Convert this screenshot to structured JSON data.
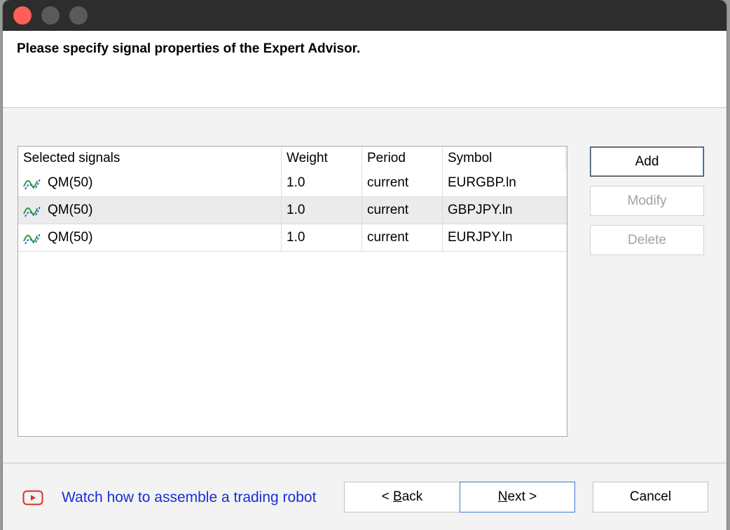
{
  "window": {
    "controls": [
      "close",
      "minimize",
      "maximize"
    ]
  },
  "header": {
    "title": "Please specify signal properties of the Expert Advisor."
  },
  "table": {
    "columns": [
      "Selected signals",
      "Weight",
      "Period",
      "Symbol"
    ],
    "rows": [
      {
        "icon": "signal-wave-icon",
        "signal": "QM(50)",
        "weight": "1.0",
        "period": "current",
        "symbol": "EURGBP.ln"
      },
      {
        "icon": "signal-wave-icon",
        "signal": "QM(50)",
        "weight": "1.0",
        "period": "current",
        "symbol": "GBPJPY.ln"
      },
      {
        "icon": "signal-wave-icon",
        "signal": "QM(50)",
        "weight": "1.0",
        "period": "current",
        "symbol": "EURJPY.ln"
      }
    ]
  },
  "side_buttons": {
    "add": "Add",
    "modify": "Modify",
    "delete": "Delete"
  },
  "footer": {
    "watch_link": "Watch how to assemble a trading robot",
    "back_prefix": "< ",
    "back_mnemonic": "B",
    "back_rest": "ack",
    "next_mnemonic": "N",
    "next_rest": "ext >",
    "cancel": "Cancel"
  },
  "colors": {
    "link": "#1a2ed6",
    "close_light": "#ff5f57",
    "youtube_red": "#d93025",
    "signal_green": "#2e9e3e",
    "signal_blue": "#2a6ad0"
  }
}
